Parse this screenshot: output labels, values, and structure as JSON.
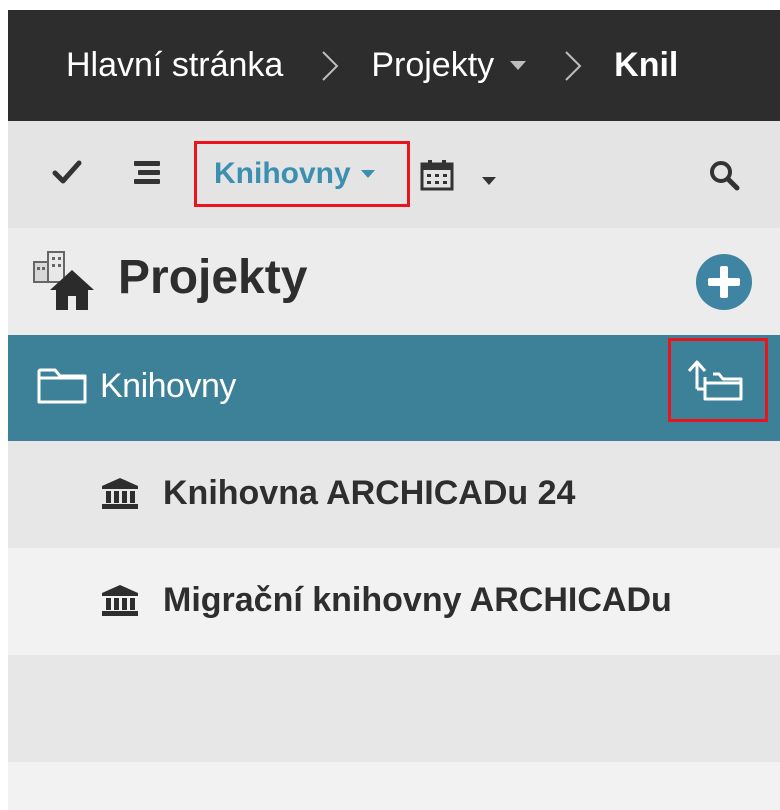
{
  "breadcrumb": {
    "home": "Hlavní stránka",
    "projects": "Projekty",
    "current": "Knil"
  },
  "toolbar": {
    "library_dropdown": "Knihovny",
    "icons": [
      "check-icon",
      "list-icon",
      "calendar-icon",
      "search-icon"
    ]
  },
  "projects_header": {
    "title": "Projekty",
    "add_icon": "plus-circle-icon"
  },
  "folder": {
    "label": "Knihovny",
    "up_icon": "folder-up-icon"
  },
  "libraries": [
    {
      "label": "Knihovna ARCHICADu 24"
    },
    {
      "label": "Migrační knihovny ARCHICADu"
    }
  ],
  "colors": {
    "breadcrumb_bg": "#2d2d2d",
    "accent": "#3b8fb0",
    "selected_row": "#3d8199",
    "highlight_border": "#e8141e"
  }
}
